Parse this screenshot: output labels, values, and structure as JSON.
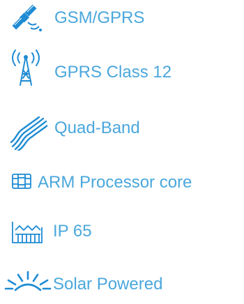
{
  "features": [
    {
      "label": "GSM/GPRS",
      "icon": "satellite-icon"
    },
    {
      "label": "GPRS Class 12",
      "icon": "antenna-tower-icon"
    },
    {
      "label": "Quad-Band",
      "icon": "wave-bands-icon"
    },
    {
      "label": "ARM Processor core",
      "icon": "processor-chip-icon"
    },
    {
      "label": "IP 65",
      "icon": "factory-icon"
    },
    {
      "label": "Solar Powered",
      "icon": "sun-rising-icon"
    }
  ],
  "colors": {
    "text": "#4aa7dc",
    "icon": "#1e8bd3"
  }
}
